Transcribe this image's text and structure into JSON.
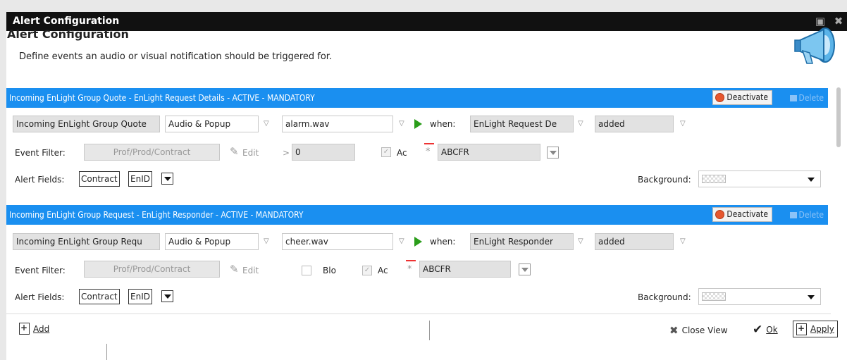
{
  "window": {
    "title": "Alert Configuration"
  },
  "header": {
    "title": "Alert Configuration",
    "subtitle": "Define events an audio or visual notification should be triggered for."
  },
  "groups": [
    {
      "bar_text": "Incoming EnLight Group Quote - EnLight Request Details - ACTIVE - MANDATORY",
      "deactivate_label": "Deactivate",
      "delete_label": "Delete",
      "event_name": "Incoming EnLight Group Quote",
      "alert_type": "Audio & Popup",
      "sound": "alarm.wav",
      "when_label": "when:",
      "when_source": "EnLight Request De",
      "when_event": "added",
      "event_filter_label": "Event Filter:",
      "filter_placeholder": "Prof/Prod/Contract",
      "edit_label": "Edit",
      "gt_label": ">",
      "gt_value": "0",
      "ac_label": "Ac",
      "code_value": "ABCFR",
      "alert_fields_label": "Alert Fields:",
      "field1": "Contract",
      "field2": "EnID",
      "background_label": "Background:"
    },
    {
      "bar_text": "Incoming EnLight Group Request - EnLight Responder - ACTIVE - MANDATORY",
      "deactivate_label": "Deactivate",
      "delete_label": "Delete",
      "event_name": "Incoming EnLight Group Requ",
      "alert_type": "Audio & Popup",
      "sound": "cheer.wav",
      "when_label": "when:",
      "when_source": "EnLight Responder",
      "when_event": "added",
      "event_filter_label": "Event Filter:",
      "filter_placeholder": "Prof/Prod/Contract",
      "edit_label": "Edit",
      "blo_label": "Blo",
      "ac_label": "Ac",
      "code_value": "ABCFR",
      "alert_fields_label": "Alert Fields:",
      "field1": "Contract",
      "field2": "EnID",
      "background_label": "Background:"
    }
  ],
  "footer": {
    "add_label": "Add",
    "close_view_label": "Close View",
    "ok_label": "Ok",
    "apply_label": "Apply"
  },
  "colors": {
    "group_bar": "#1a8ff0",
    "titlebar": "#111111",
    "play": "#2a9d1a"
  }
}
